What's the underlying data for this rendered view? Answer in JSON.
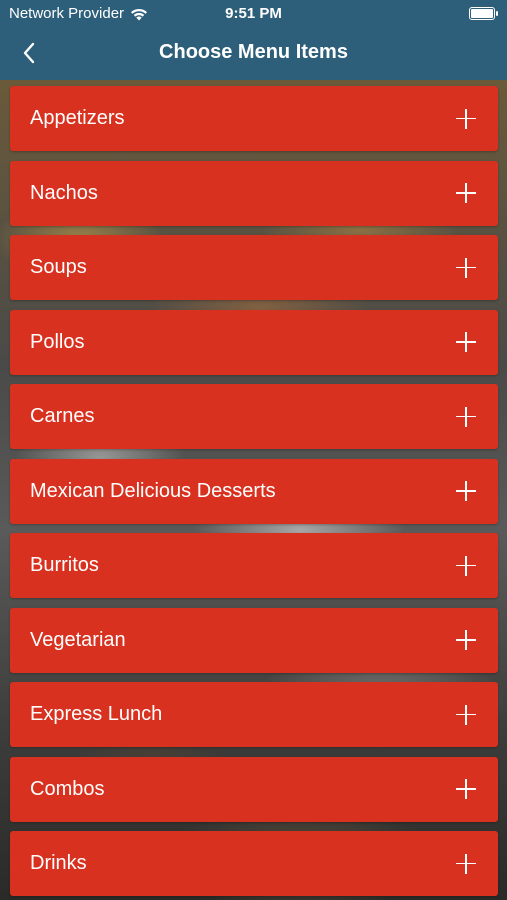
{
  "status_bar": {
    "carrier": "Network Provider",
    "time": "9:51 PM"
  },
  "nav": {
    "title": "Choose Menu Items",
    "back_icon": "chevron-left-icon"
  },
  "menu": {
    "items": [
      {
        "label": "Appetizers"
      },
      {
        "label": "Nachos"
      },
      {
        "label": "Soups"
      },
      {
        "label": "Pollos"
      },
      {
        "label": "Carnes"
      },
      {
        "label": "Mexican Delicious Desserts"
      },
      {
        "label": "Burritos"
      },
      {
        "label": "Vegetarian"
      },
      {
        "label": "Express Lunch"
      },
      {
        "label": "Combos"
      },
      {
        "label": "Drinks"
      }
    ],
    "expand_icon": "plus-icon"
  },
  "colors": {
    "header": "#2e5f7a",
    "item_background": "#d9311f",
    "text": "#ffffff"
  }
}
